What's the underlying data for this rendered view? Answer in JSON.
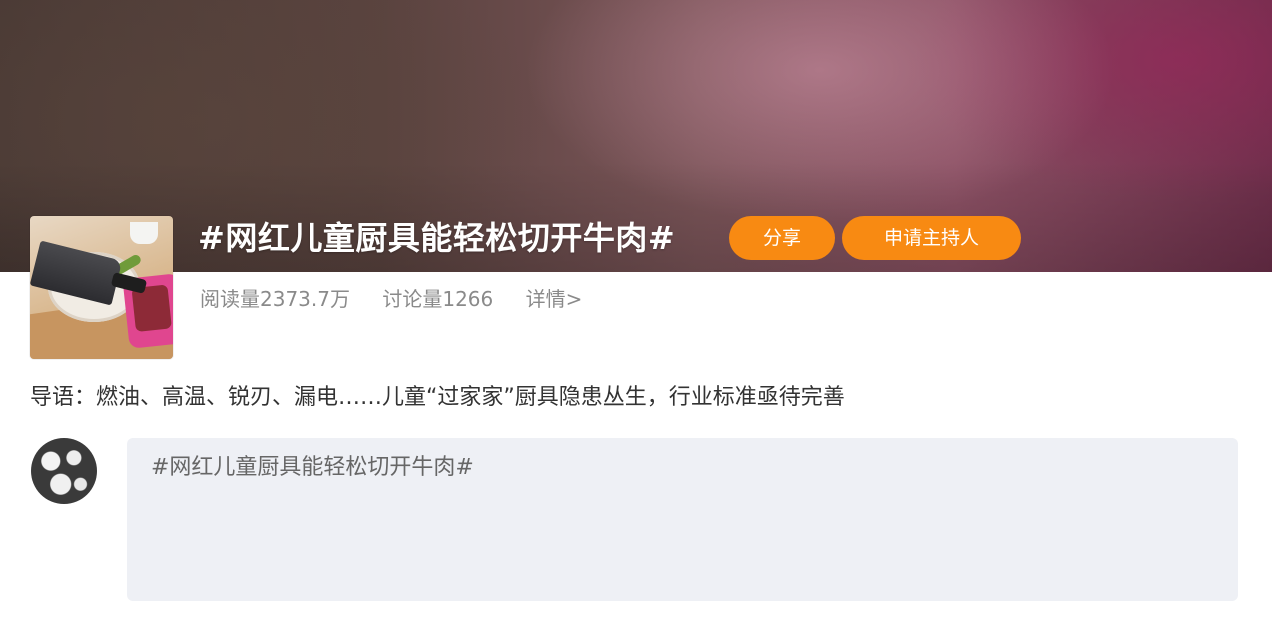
{
  "topic": {
    "title": "#网红儿童厨具能轻松切开牛肉#",
    "share_label": "分享",
    "host_label": "申请主持人",
    "reads": "阅读量2373.7万",
    "discussions": "讨论量1266",
    "details": "详情>"
  },
  "intro": {
    "text": "导语：燃油、高温、锐刃、漏电……儿童“过家家”厨具隐患丛生，行业标准亟待完善"
  },
  "composer": {
    "text": "#网红儿童厨具能轻松切开牛肉#"
  },
  "colors": {
    "accent_button": "#f88a12",
    "banner_dark": "#4a3a35",
    "banner_magenta": "#6e2f4b",
    "composer_bg": "#eef0f5",
    "muted_text": "#8a8a8a"
  }
}
